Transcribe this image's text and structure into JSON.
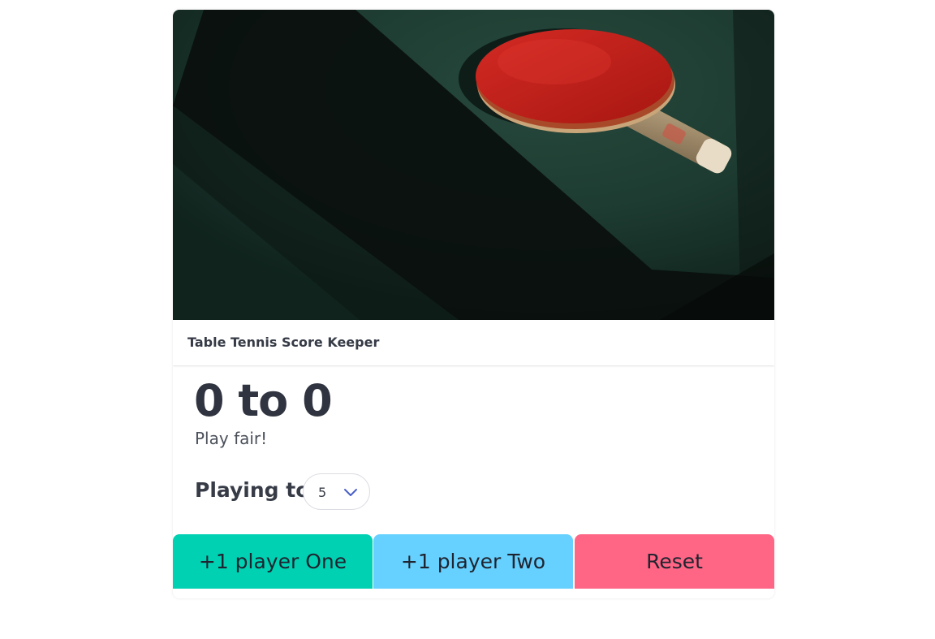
{
  "card": {
    "title": "Table Tennis Score Keeper",
    "image_alt": "Red table tennis paddle lying on a dark green table"
  },
  "score": {
    "text": "0 to 0",
    "subtitle": "Play fair!"
  },
  "settings": {
    "playing_to_label": "Playing to",
    "selected_value": "5"
  },
  "buttons": {
    "player_one": "+1 player One",
    "player_two": "+1 player Two",
    "reset": "Reset"
  },
  "colors": {
    "player_one_bg": "#00d1b2",
    "player_two_bg": "#66d1ff",
    "reset_bg": "#ff6685",
    "chevron": "#485fc7"
  },
  "icons": {
    "select_arrow": "chevron-down-icon"
  }
}
